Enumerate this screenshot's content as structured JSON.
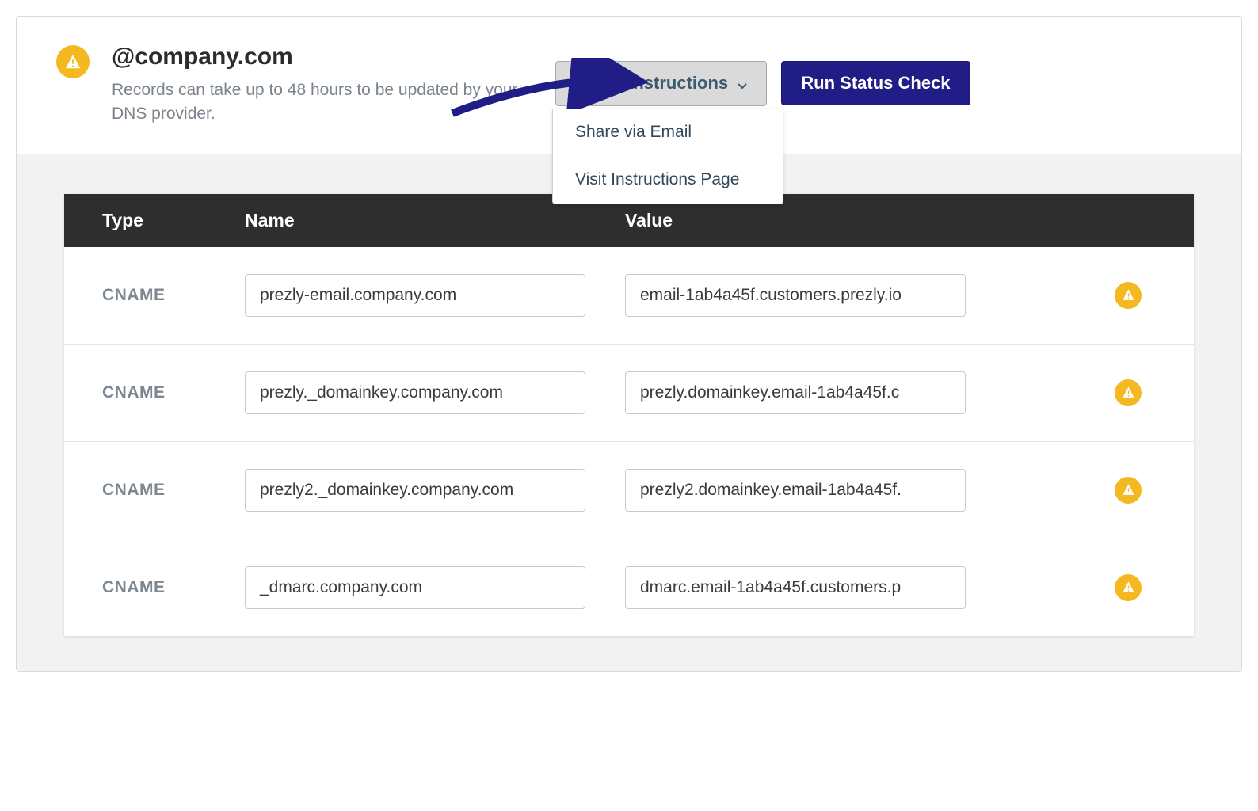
{
  "header": {
    "domain": "@company.com",
    "subtitle": "Records can take up to 48 hours to be updated by your DNS provider.",
    "share_button": "Share Instructions",
    "run_button": "Run Status Check",
    "dropdown": {
      "share_email": "Share via Email",
      "visit_page": "Visit Instructions Page"
    }
  },
  "columns": {
    "type": "Type",
    "name": "Name",
    "value": "Value"
  },
  "rows": [
    {
      "type": "CNAME",
      "name": "prezly-email.company.com",
      "value": "email-1ab4a45f.customers.prezly.io"
    },
    {
      "type": "CNAME",
      "name": "prezly._domainkey.company.com",
      "value": "prezly.domainkey.email-1ab4a45f.c"
    },
    {
      "type": "CNAME",
      "name": "prezly2._domainkey.company.com",
      "value": "prezly2.domainkey.email-1ab4a45f."
    },
    {
      "type": "CNAME",
      "name": "_dmarc.company.com",
      "value": "dmarc.email-1ab4a45f.customers.p"
    }
  ]
}
